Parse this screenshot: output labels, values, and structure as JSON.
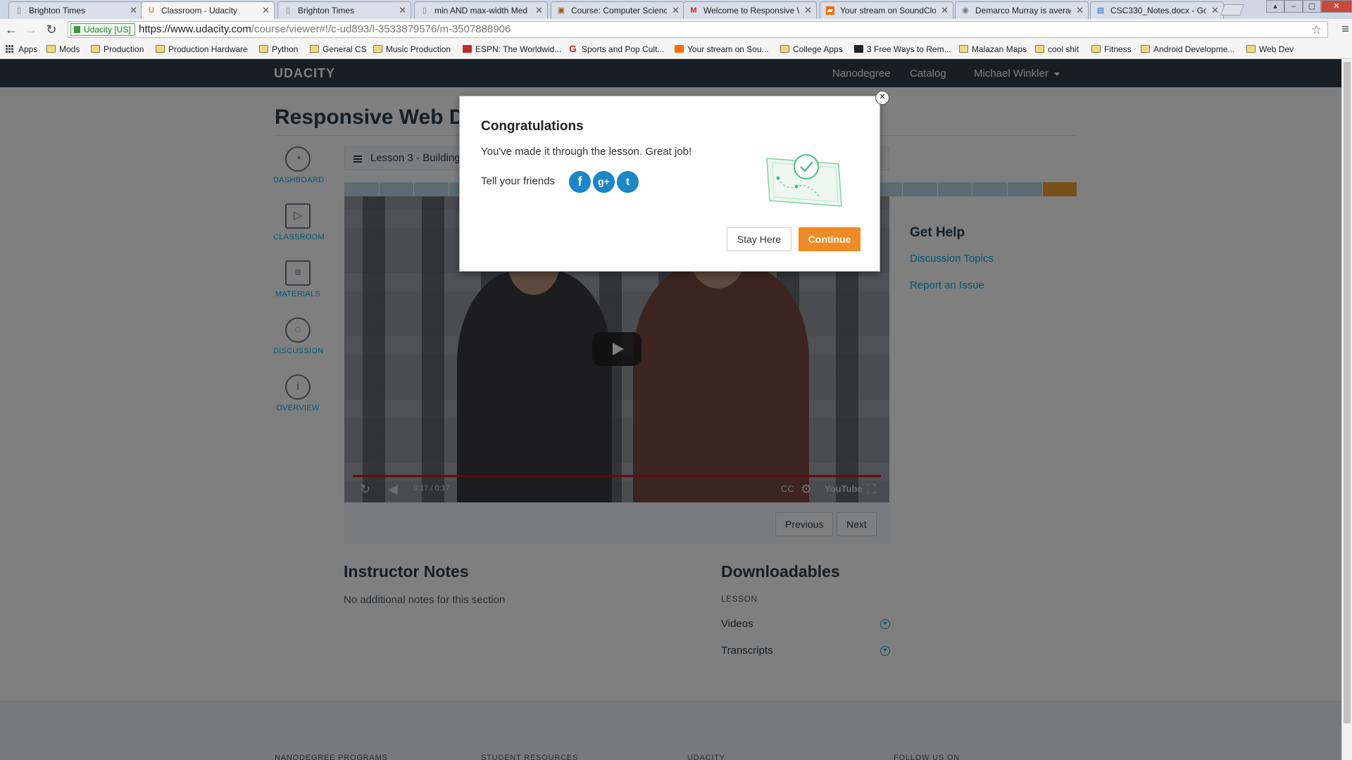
{
  "browser": {
    "tabs": [
      {
        "title": "Brighton Times",
        "active": false
      },
      {
        "title": "Classroom - Udacity",
        "active": true
      },
      {
        "title": "Brighton Times",
        "active": false
      },
      {
        "title": "min AND max-width Med",
        "active": false
      },
      {
        "title": "Course: Computer Scienc",
        "active": false
      },
      {
        "title": "Welcome to Responsive W",
        "active": false
      },
      {
        "title": "Your stream on SoundClo",
        "active": false
      },
      {
        "title": "Demarco Murray is averag",
        "active": false
      },
      {
        "title": "CSC330_Notes.docx - Goo",
        "active": false
      }
    ],
    "secure_label": "Udacity [US]",
    "url_host": "https://www.udacity.com",
    "url_path": "/course/viewer#!/c-ud893/l-3533879576/m-3507888906",
    "bookmarks": [
      "Apps",
      "Mods",
      "Production",
      "Production Hardware",
      "Python",
      "General CS",
      "Music Production",
      "ESPN: The Worldwid...",
      "Sports and Pop Cult...",
      "Your stream on Sou...",
      "College Apps",
      "3 Free Ways to Rem...",
      "Malazan Maps",
      "cool shit",
      "Fitness",
      "Android Developme...",
      "Web Dev"
    ]
  },
  "topnav": {
    "logo": "UDACITY",
    "nanodegree": "Nanodegree",
    "catalog": "Catalog",
    "user": "Michael Winkler"
  },
  "course_title": "Responsive Web Design Fundamentals",
  "sidenav": {
    "dashboard": "DASHBOARD",
    "classroom": "CLASSROOM",
    "materials": "MATERIALS",
    "discussion": "DISCUSSION",
    "overview": "OVERVIEW"
  },
  "lesson_bar": "Lesson 3 - Building Up",
  "progress": {
    "segments": 21,
    "current_index": 20
  },
  "video": {
    "time": "0:17 / 0:17",
    "youtube": "YouTube"
  },
  "pager": {
    "previous": "Previous",
    "next": "Next"
  },
  "help": {
    "title": "Get Help",
    "discussion": "Discussion Topics",
    "report": "Report an Issue"
  },
  "instructor_notes": {
    "title": "Instructor Notes",
    "body": "No additional notes for this section"
  },
  "downloadables": {
    "title": "Downloadables",
    "label": "LESSON",
    "videos": "Videos",
    "transcripts": "Transcripts"
  },
  "footer": {
    "headings": [
      "NANODEGREE PROGRAMS",
      "STUDENT RESOURCES",
      "UDACITY",
      "FOLLOW US ON"
    ]
  },
  "modal": {
    "title": "Congratulations",
    "message": "You've made it through the lesson. Great job!",
    "tell": "Tell your friends",
    "stay": "Stay Here",
    "continue": "Continue",
    "close": "×",
    "colors": {
      "accent": "#f08a24",
      "social": "#1b86c8"
    }
  }
}
